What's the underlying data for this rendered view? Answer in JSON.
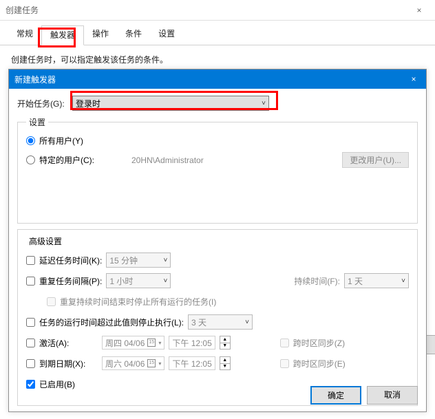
{
  "window": {
    "title": "创建任务",
    "close_icon": "×"
  },
  "tabs": {
    "general": "常规",
    "triggers": "触发器",
    "actions": "操作",
    "conditions": "条件",
    "settings": "设置"
  },
  "content": {
    "intro": "创建任务时，可以指定触发该任务的条件。"
  },
  "modal": {
    "title": "新建触发器",
    "close": "×",
    "begin_label": "开始任务(G):",
    "begin_value": "登录时",
    "settings_legend": "设置",
    "radio_any": "所有用户(Y)",
    "radio_specific": "特定的用户(C):",
    "specific_user": "20HN\\Administrator",
    "change_user_btn": "更改用户(U)...",
    "adv_legend": "高级设置",
    "adv": {
      "delay_label": "延迟任务时间(K):",
      "delay_val": "15 分钟",
      "repeat_label": "重复任务间隔(P):",
      "repeat_val": "1 小时",
      "duration_label": "持续时间(F):",
      "duration_val": "1 天",
      "stop_end_label": "重复持续时间结束时停止所有运行的任务(I)",
      "stop_after_label": "任务的运行时间超过此值则停止执行(L):",
      "stop_after_val": "3 天",
      "activate_label": "激活(A):",
      "activate_date": "周四 04/06",
      "activate_time": "下午 12:05",
      "activate_tz": "跨时区同步(Z)",
      "expire_label": "到期日期(X):",
      "expire_date": "周六 04/06",
      "expire_time": "下午 12:05",
      "expire_tz": "跨时区同步(E)",
      "enabled_label": "已启用(B)"
    },
    "ok": "确定",
    "cancel": "取消"
  }
}
